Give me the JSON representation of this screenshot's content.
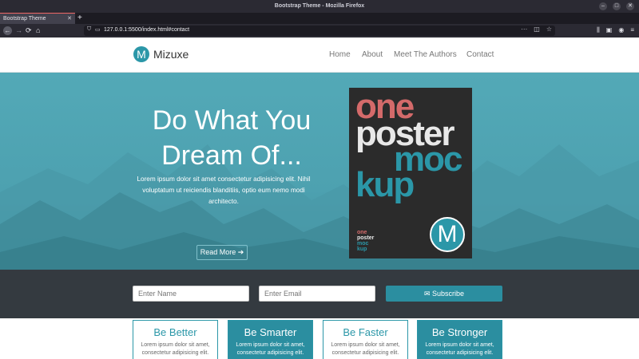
{
  "window": {
    "title": "Bootstrap Theme - Mozilla Firefox",
    "tab_title": "Bootstrap Theme",
    "url": "127.0.0.1:5500/index.html#contact",
    "controls": [
      "–",
      "□",
      "✕"
    ]
  },
  "site": {
    "brand_logo": "M",
    "brand_name": "Mizuxe",
    "menu": [
      "Home",
      "About",
      "Meet The Authors",
      "Contact"
    ]
  },
  "hero": {
    "title": "Do What You Dream Of...",
    "text": "Lorem ipsum dolor sit amet consectetur adipisicing elit. Nihil voluptatum ut reiciendis blanditiis, optio eum nemo modi architecto.",
    "button_label": "Read More",
    "poster": {
      "line1": "one",
      "line2": "poster",
      "line3": "moc",
      "line4": "kup",
      "small1": "one",
      "small2": "poster",
      "small3": "moc",
      "small4": "kup",
      "badge": "M"
    }
  },
  "subscribe": {
    "name_placeholder": "Enter Name",
    "email_placeholder": "Enter Email",
    "button_label": "Subscribe"
  },
  "features": [
    {
      "title": "Be Better",
      "text1": "Lorem ipsum dolor sit amet,",
      "text2": "consectetur adipisicing elit."
    },
    {
      "title": "Be Smarter",
      "text1": "Lorem ipsum dolor sit amet,",
      "text2": "consectetur adipisicing elit."
    },
    {
      "title": "Be Faster",
      "text1": "Lorem ipsum dolor sit amet,",
      "text2": "consectetur adipisicing elit."
    },
    {
      "title": "Be Stronger",
      "text1": "Lorem ipsum dolor sit amet,",
      "text2": "consectetur adipisicing elit."
    }
  ],
  "colors": {
    "accent": "#2b97a8",
    "hero": "#53a9b7",
    "dark_band": "#343a40",
    "poster_bg": "#2b2b2b",
    "poster_red": "#d46a6a"
  }
}
